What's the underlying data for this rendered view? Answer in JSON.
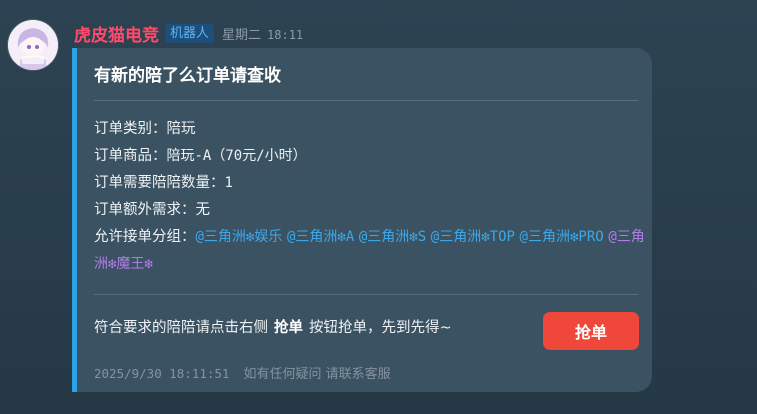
{
  "message": {
    "sender_name": "虎皮猫电竞",
    "sender_badge": "机器人",
    "weekday": "星期二",
    "time": "18:11"
  },
  "card": {
    "title": "有新的陪了么订单请查收",
    "fields": [
      {
        "label": "订单类别：",
        "value": "陪玩"
      },
      {
        "label": "订单商品：",
        "value": "陪玩-A（70元/小时）"
      },
      {
        "label": "订单需要陪陪数量：",
        "value": "1"
      },
      {
        "label": "订单额外需求：",
        "value": "无"
      }
    ],
    "groups_label": "允许接单分组：",
    "groups": [
      "@三角洲❇娱乐",
      "@三角洲❇A",
      "@三角洲❇S",
      "@三角洲❇TOP",
      "@三角洲❇PRO",
      "@三角洲❇魔王❇"
    ],
    "instruction_prefix": "符合要求的陪陪请点击右侧",
    "instruction_bold": "抢单",
    "instruction_suffix": "按钮抢单，先到先得~",
    "grab_button_label": "抢单",
    "footer_timestamp": "2025/9/30 18:11:51",
    "footer_note": "如有任何疑问 请联系客服"
  },
  "colors": {
    "accent_bar": "#2da3e6",
    "sender_name": "#ff4a6b",
    "mention": "#3aa8ea",
    "mention_special": "#b07ce8",
    "grab_button": "#f0473b"
  }
}
